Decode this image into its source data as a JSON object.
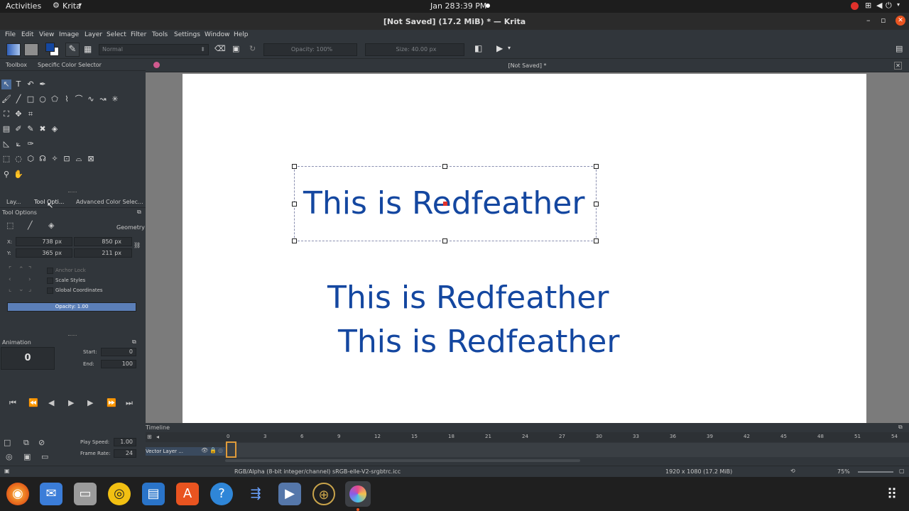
{
  "system_bar": {
    "activities": "Activities",
    "app": "Krita",
    "date": "Jan 28",
    "time": "3:39 PM"
  },
  "window": {
    "title": "[Not Saved]  (17.2 MiB)  * — Krita"
  },
  "menu": [
    "File",
    "Edit",
    "View",
    "Image",
    "Layer",
    "Select",
    "Filter",
    "Tools",
    "Settings",
    "Window",
    "Help"
  ],
  "toolbar": {
    "blend_mode": "Normal",
    "opacity": "Opacity: 100%",
    "size": "Size: 40.00 px"
  },
  "document_tab": {
    "label": "[Not Saved]  *"
  },
  "toolbox": {
    "tabs": [
      "Toolbox",
      "Specific Color Selector"
    ]
  },
  "dock_tabs": [
    "Lay...",
    "Tool Opti...",
    "Advanced Color Selec..."
  ],
  "tool_options": {
    "title": "Tool Options",
    "geometry": "Geometry",
    "x_label": "X:",
    "x_value": "738 px",
    "y_label": "Y:",
    "y_value": "365 px",
    "w_value": "850 px",
    "h_value": "211 px",
    "anchor_lock": "Anchor Lock",
    "scale_styles": "Scale Styles",
    "global_coords": "Global Coordinates",
    "opacity": "Opacity: 1.00"
  },
  "animation": {
    "title": "Animation",
    "frame": "0",
    "start_label": "Start:",
    "start": "0",
    "end_label": "End:",
    "end": "100",
    "play_speed_label": "Play Speed:",
    "play_speed": "1.00",
    "frame_rate_label": "Frame Rate:",
    "frame_rate": "24"
  },
  "canvas": {
    "text1": "This is Redfeather",
    "text2": "This is Redfeather",
    "text3": "This is Redfeather"
  },
  "timeline": {
    "title": "Timeline",
    "layer": "Vector Layer ...",
    "ticks": [
      "0",
      "3",
      "6",
      "9",
      "12",
      "15",
      "18",
      "21",
      "24",
      "27",
      "30",
      "33",
      "36",
      "39",
      "42",
      "45",
      "48",
      "51",
      "54"
    ]
  },
  "status": {
    "color_profile": "RGB/Alpha (8-bit integer/channel)  sRGB-elle-V2-srgbtrc.icc",
    "dimensions": "1920 x 1080 (17.2 MiB)",
    "zoom": "75%"
  },
  "colors": {
    "text_blue": "#1447a0",
    "accent": "#5b7fb8",
    "record": "#e0312b"
  }
}
